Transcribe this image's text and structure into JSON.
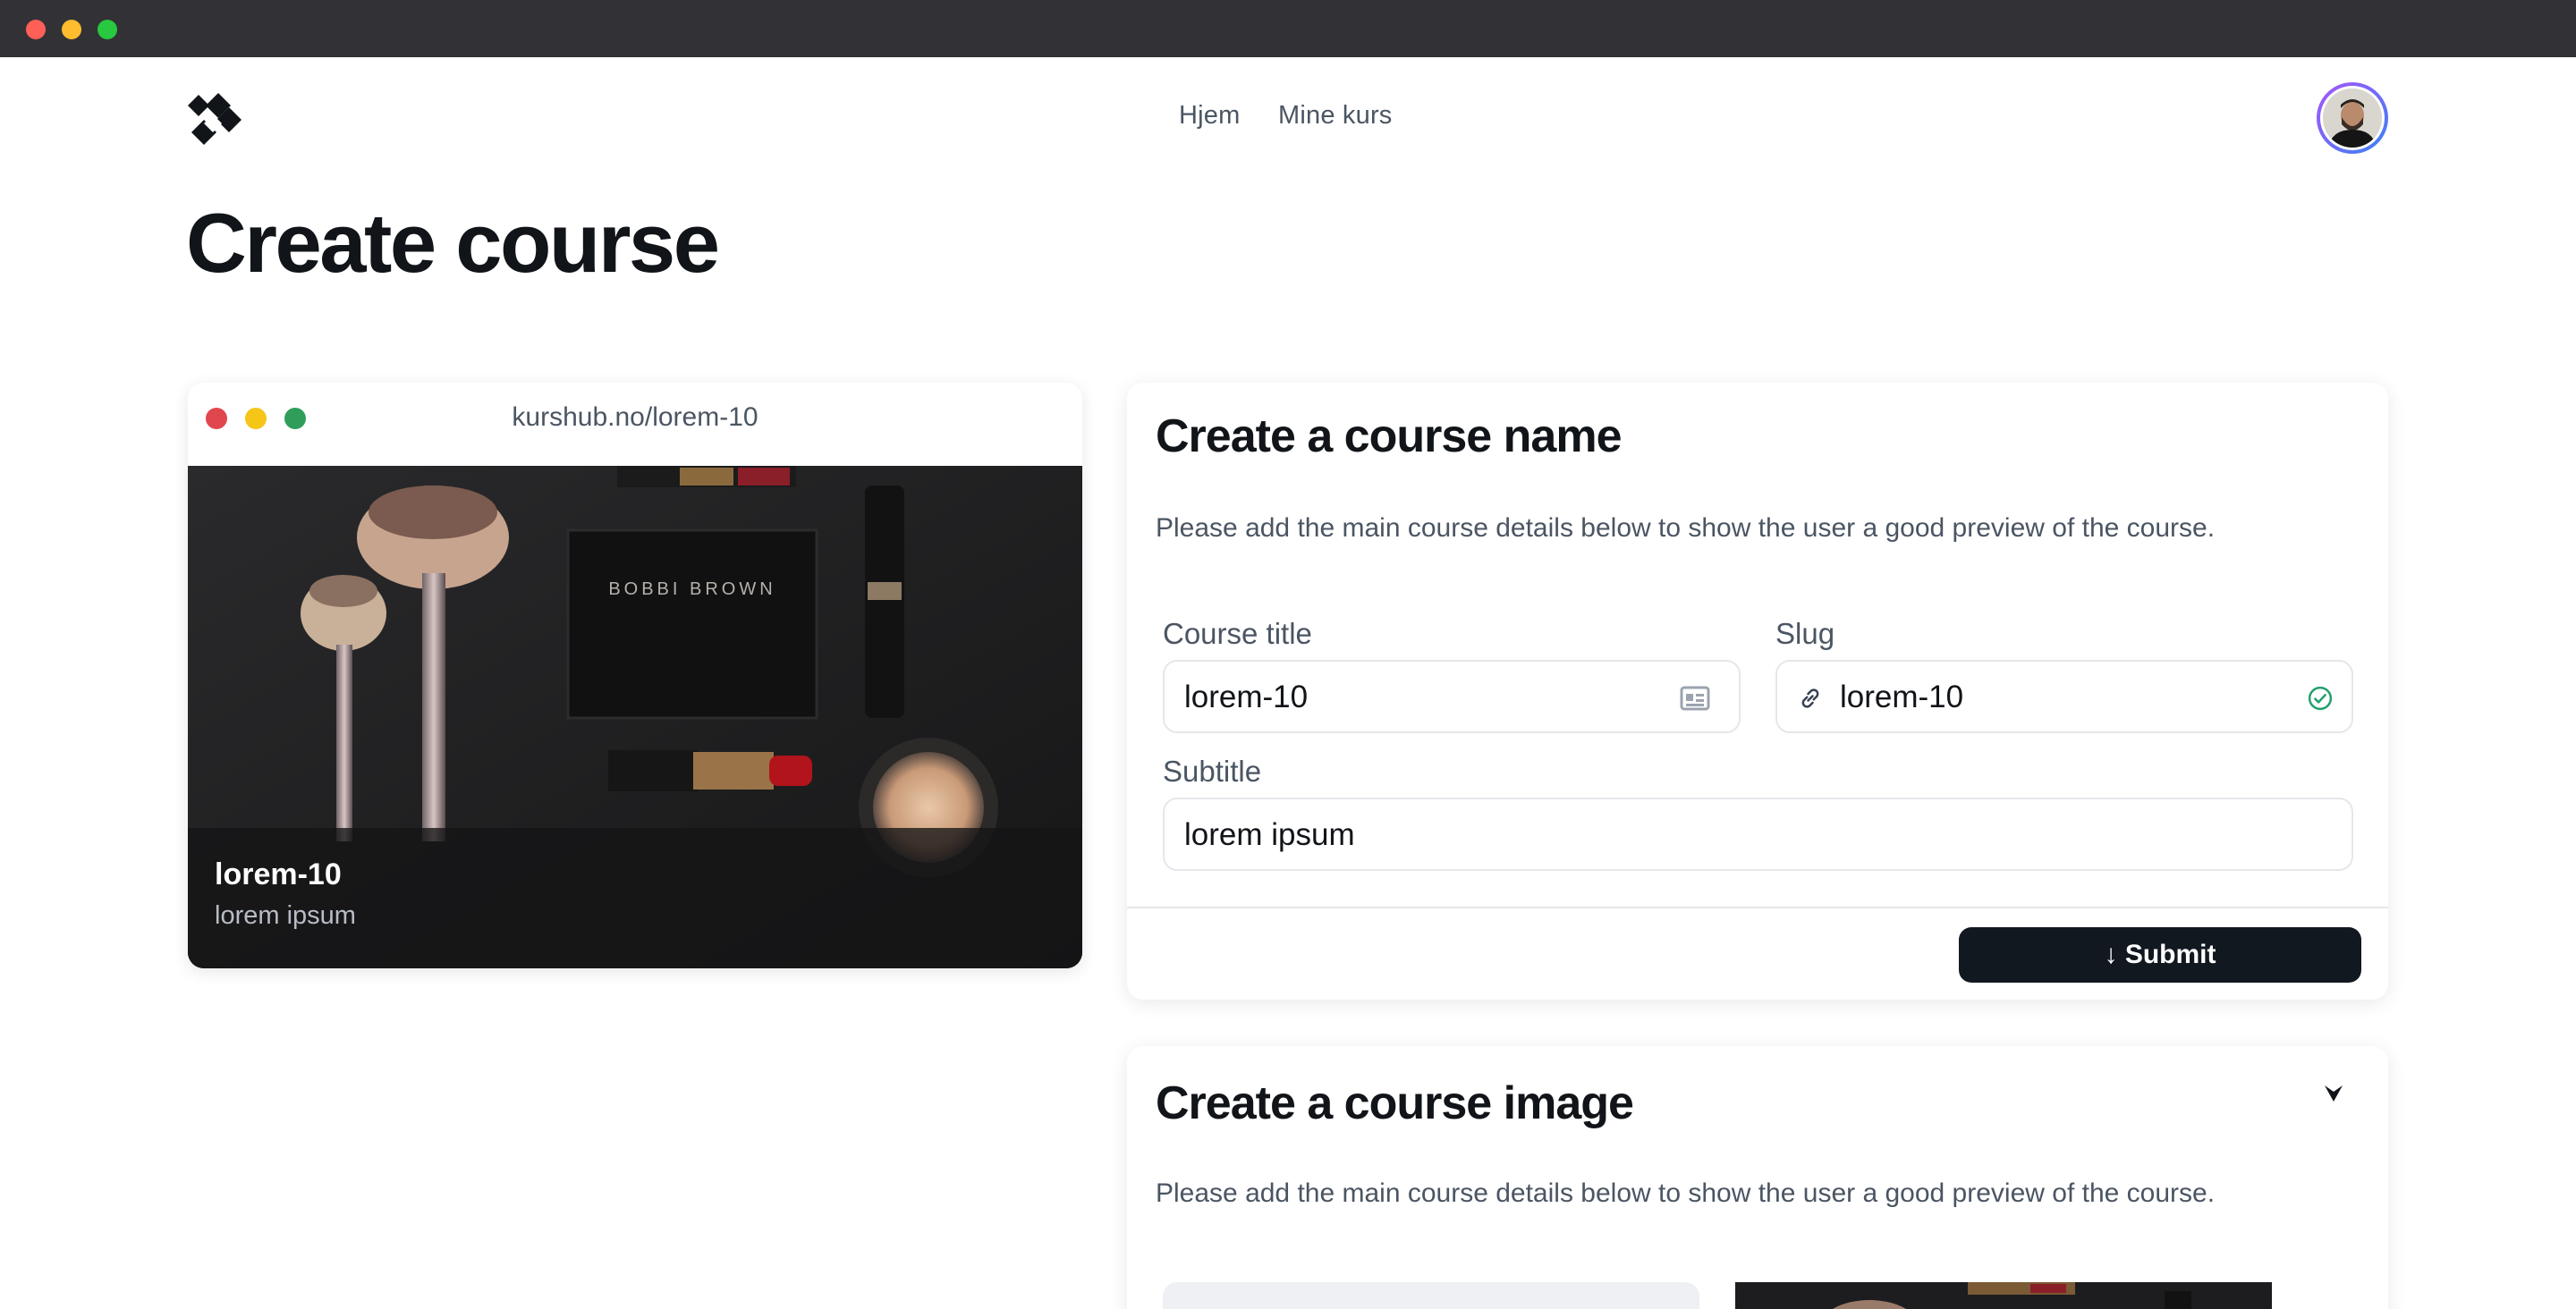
{
  "window": {
    "title": ""
  },
  "nav": {
    "links": [
      "Hjem",
      "Mine kurs"
    ],
    "logo": "brand-logo-icon",
    "avatar": "user-avatar"
  },
  "page": {
    "title": "Create course"
  },
  "preview": {
    "url": "kurshub.no/lorem-10",
    "title": "lorem-10",
    "subtitle": "lorem ipsum"
  },
  "name_card": {
    "heading": "Create a course name",
    "description": "Please add the main course details below to show the user a good preview of the course.",
    "course_title_label": "Course title",
    "course_title_value": "lorem-10",
    "slug_label": "Slug",
    "slug_value": "lorem-10",
    "subtitle_label": "Subtitle",
    "subtitle_value": "lorem ipsum",
    "submit_label": "↓ Submit"
  },
  "image_card": {
    "heading": "Create a course image",
    "description": "Please add the main course details below to show the user a good preview of the course."
  },
  "colors": {
    "primary_button": "#111820",
    "slug_valid": "#22a06b",
    "avatar_ring_from": "#a855f7",
    "avatar_ring_to": "#3b82f6"
  }
}
